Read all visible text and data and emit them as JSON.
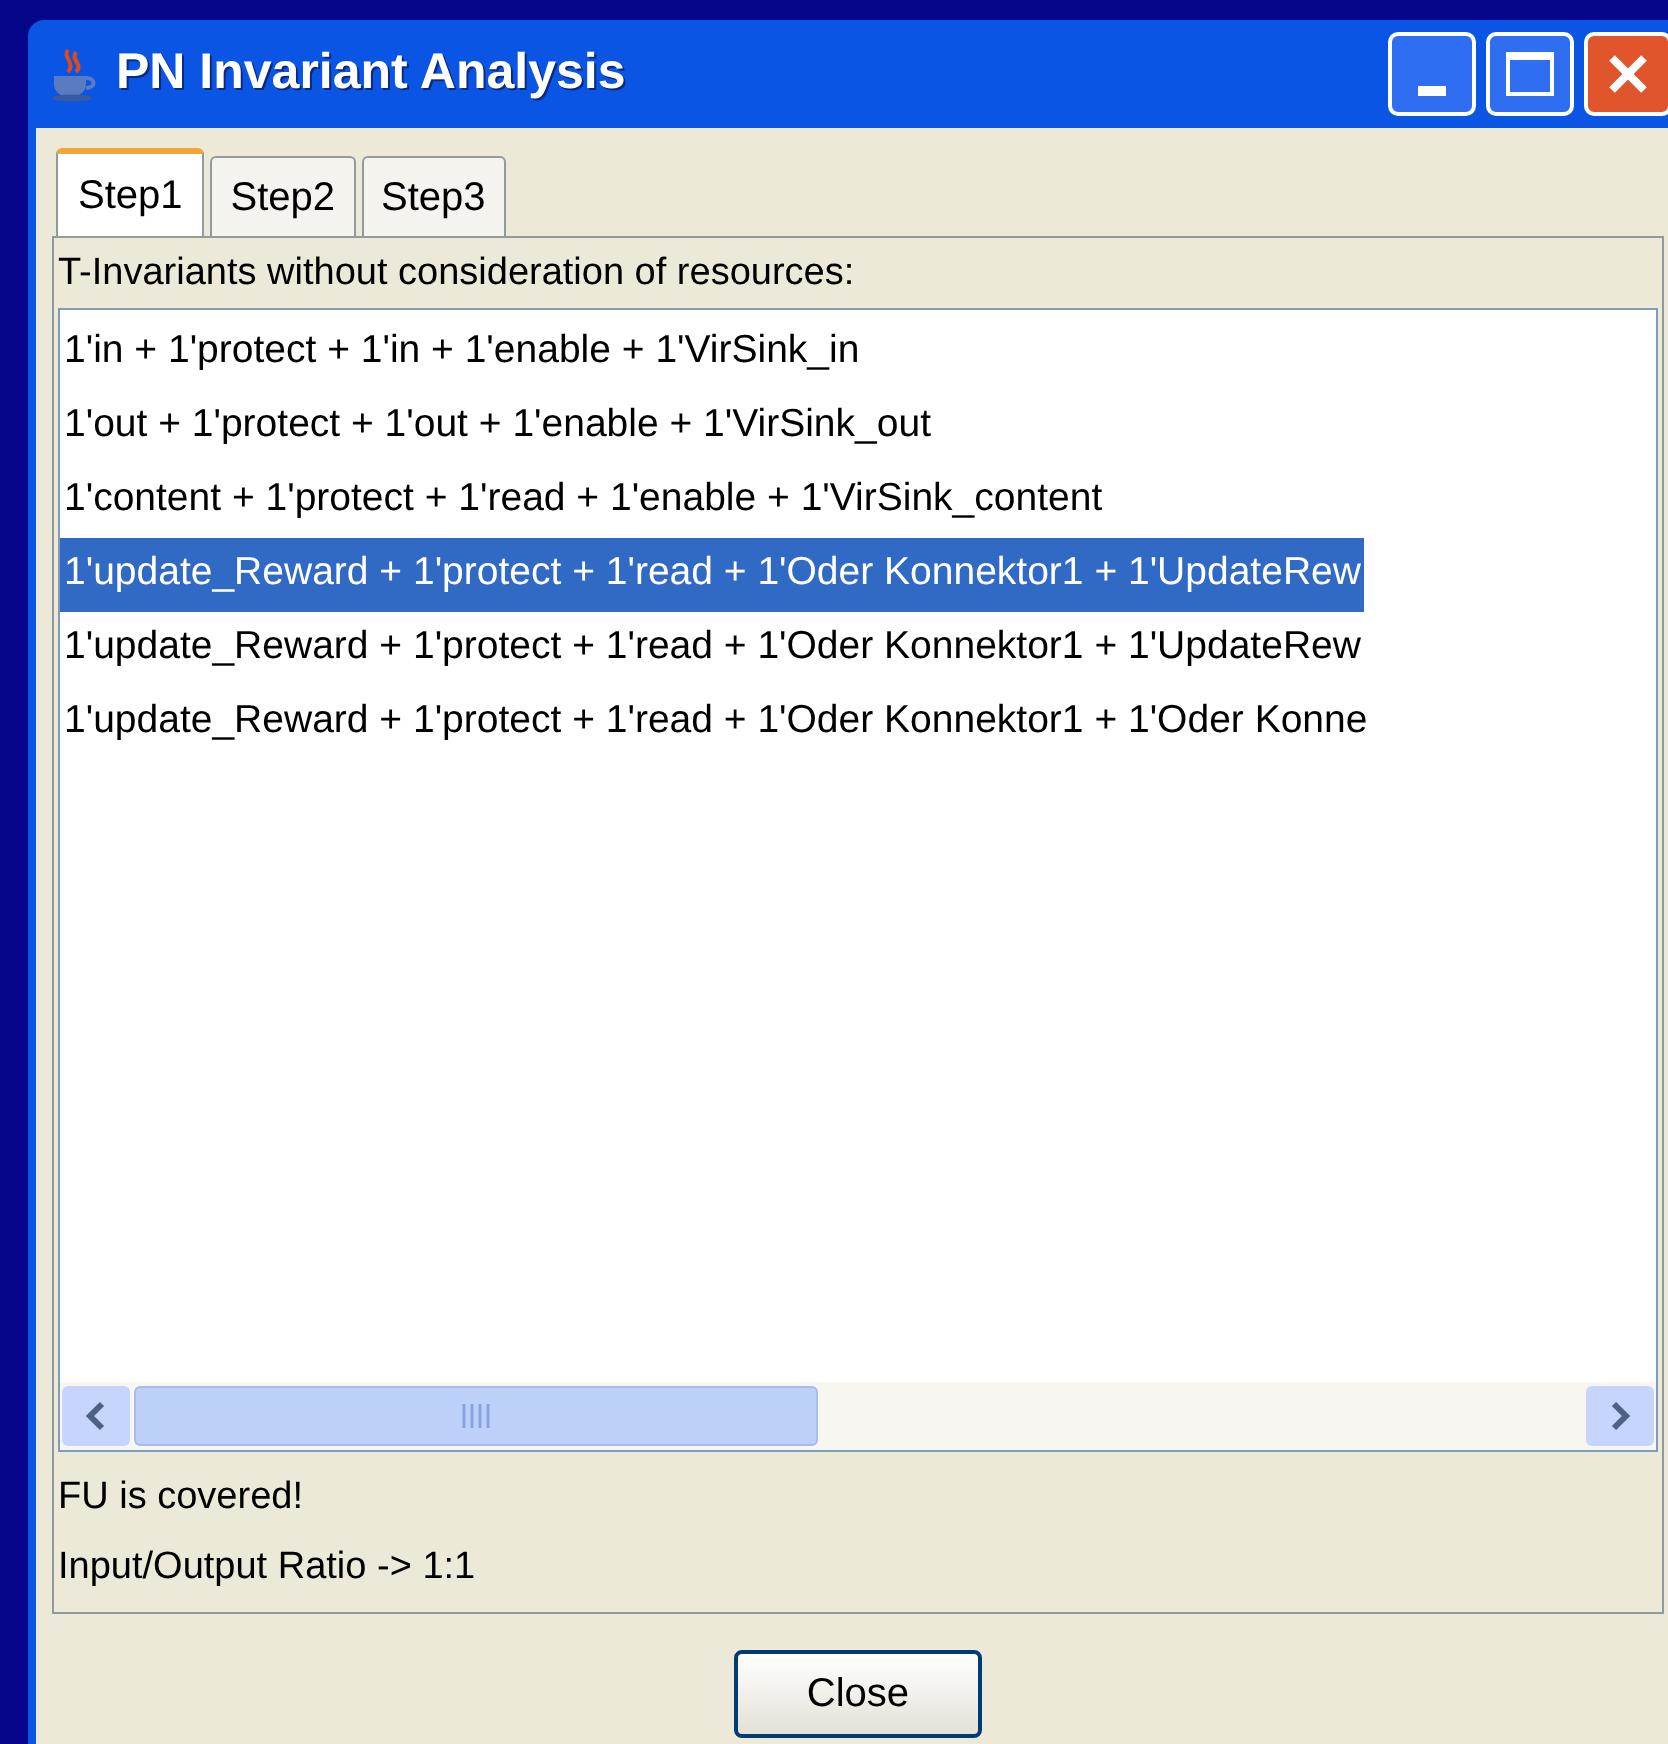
{
  "window": {
    "title": "PN Invariant Analysis"
  },
  "tabs": [
    {
      "label": "Step1",
      "selected": true
    },
    {
      "label": "Step2",
      "selected": false
    },
    {
      "label": "Step3",
      "selected": false
    }
  ],
  "list_heading": "T-Invariants without consideration of resources:",
  "invariants": [
    {
      "text": "1'in + 1'protect + 1'in + 1'enable + 1'VirSink_in",
      "selected": false
    },
    {
      "text": "1'out + 1'protect + 1'out + 1'enable + 1'VirSink_out",
      "selected": false
    },
    {
      "text": "1'content + 1'protect + 1'read + 1'enable + 1'VirSink_content",
      "selected": false
    },
    {
      "text": "1'update_Reward + 1'protect + 1'read + 1'Oder Konnektor1 + 1'UpdateRew",
      "selected": true
    },
    {
      "text": "1'update_Reward + 1'protect + 1'read + 1'Oder Konnektor1 + 1'UpdateRew",
      "selected": false
    },
    {
      "text": "1'update_Reward + 1'protect + 1'read + 1'Oder Konnektor1 + 1'Oder Konne",
      "selected": false
    }
  ],
  "status_lines": [
    "FU is covered!",
    "Input/Output Ratio -> 1:1"
  ],
  "buttons": [
    "Close"
  ]
}
